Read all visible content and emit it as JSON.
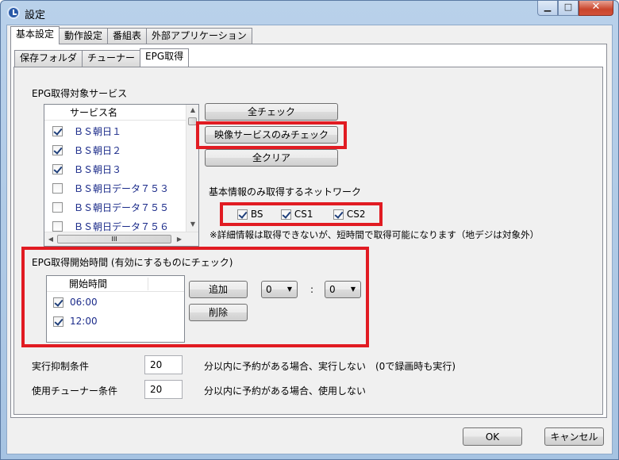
{
  "window": {
    "title": "設定",
    "close_glyph": "✕",
    "min_glyph": "▁",
    "max_glyph": "□"
  },
  "tabs_outer": [
    "基本設定",
    "動作設定",
    "番組表",
    "外部アプリケーション"
  ],
  "tabs_inner": [
    "保存フォルダ",
    "チューナー",
    "EPG取得"
  ],
  "epg_services": {
    "section_label": "EPG取得対象サービス",
    "column_header": "サービス名",
    "items": [
      {
        "name": "ＢＳ朝日１",
        "checked": true
      },
      {
        "name": "ＢＳ朝日２",
        "checked": true
      },
      {
        "name": "ＢＳ朝日３",
        "checked": true
      },
      {
        "name": "ＢＳ朝日データ７５３",
        "checked": false
      },
      {
        "name": "ＢＳ朝日データ７５５",
        "checked": false
      },
      {
        "name": "ＢＳ朝日データ７５６",
        "checked": false
      }
    ],
    "hscroll_thumb_glyph": "III"
  },
  "buttons": {
    "check_all": "全チェック",
    "check_video_only": "映像サービスのみチェック",
    "clear_all": "全クリア",
    "add": "追加",
    "delete": "削除",
    "ok": "OK",
    "cancel": "キャンセル"
  },
  "network": {
    "label": "基本情報のみ取得するネットワーク",
    "options": [
      {
        "name": "BS",
        "checked": true
      },
      {
        "name": "CS1",
        "checked": true
      },
      {
        "name": "CS2",
        "checked": true
      }
    ],
    "note": "※詳細情報は取得できないが、短時間で取得可能になります（地デジは対象外）"
  },
  "start_time": {
    "label": "EPG取得開始時間 (有効にするものにチェック)",
    "column_header": "開始時間",
    "items": [
      {
        "time": "06:00",
        "checked": true
      },
      {
        "time": "12:00",
        "checked": true
      }
    ],
    "hour_value": "0",
    "minute_value": "0",
    "separator": ":"
  },
  "conditions": {
    "exec_suppress_label": "実行抑制条件",
    "exec_suppress_value": "20",
    "exec_suppress_desc": "分以内に予約がある場合、実行しない　(0で録画時も実行)",
    "tuner_cond_label": "使用チューナー条件",
    "tuner_cond_value": "20",
    "tuner_cond_desc": "分以内に予約がある場合、使用しない"
  },
  "colors": {
    "highlight": "#e11b22",
    "list_text": "#1b2b8a"
  }
}
